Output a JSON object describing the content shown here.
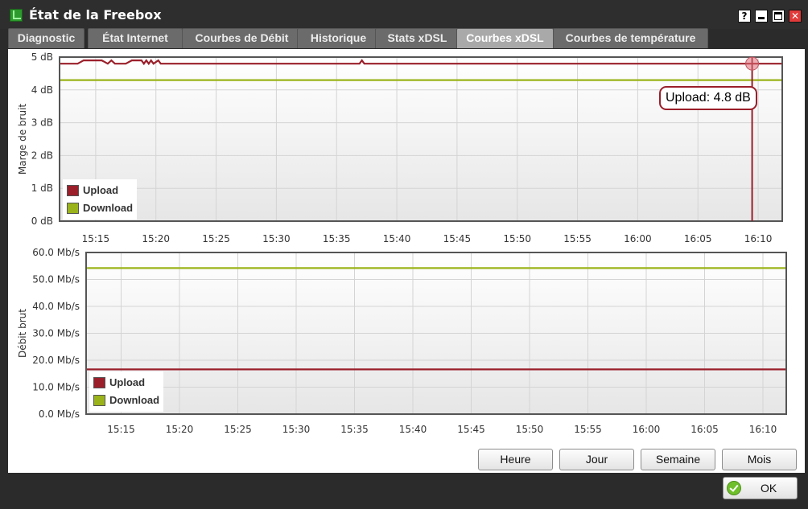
{
  "window": {
    "title": "État de la Freebox",
    "controls": {
      "help": "?",
      "close": "✕"
    }
  },
  "tabs": [
    {
      "label": "Diagnostic",
      "active": false
    },
    {
      "label": "État Internet",
      "active": false
    },
    {
      "label": "Courbes de Débit",
      "active": false
    },
    {
      "label": "Historique",
      "active": false
    },
    {
      "label": "Stats xDSL",
      "active": false
    },
    {
      "label": "Courbes xDSL",
      "active": true
    },
    {
      "label": "Courbes de température",
      "active": false
    }
  ],
  "chart_data": [
    {
      "type": "line",
      "ylabel": "Marge de bruit",
      "yticks": [
        "0 dB",
        "1 dB",
        "2 dB",
        "3 dB",
        "4 dB",
        "5 dB"
      ],
      "ylim": [
        0,
        5
      ],
      "xticks": [
        "15:15",
        "15:20",
        "15:25",
        "15:30",
        "15:35",
        "15:40",
        "15:45",
        "15:50",
        "15:55",
        "16:00",
        "16:05",
        "16:10"
      ],
      "series": [
        {
          "name": "Upload",
          "color": "#9a1f2a",
          "points": [
            [
              "15:12",
              4.8
            ],
            [
              "15:13.5",
              4.8
            ],
            [
              "15:14",
              4.9
            ],
            [
              "15:15.5",
              4.9
            ],
            [
              "15:16",
              4.8
            ],
            [
              "15:16.3",
              4.9
            ],
            [
              "15:16.6",
              4.8
            ],
            [
              "15:17.5",
              4.8
            ],
            [
              "15:18",
              4.9
            ],
            [
              "15:18.8",
              4.9
            ],
            [
              "15:19",
              4.8
            ],
            [
              "15:19.2",
              4.9
            ],
            [
              "15:19.4",
              4.8
            ],
            [
              "15:19.6",
              4.9
            ],
            [
              "15:19.8",
              4.8
            ],
            [
              "15:20.2",
              4.9
            ],
            [
              "15:20.4",
              4.8
            ],
            [
              "15:36.9",
              4.8
            ],
            [
              "15:37.1",
              4.9
            ],
            [
              "15:37.3",
              4.8
            ],
            [
              "16:12",
              4.8
            ]
          ]
        },
        {
          "name": "Download",
          "color": "#9bb31a",
          "points": [
            [
              "15:12",
              4.3
            ],
            [
              "16:12",
              4.3
            ]
          ]
        }
      ],
      "tooltip": "Upload: 4.8 dB",
      "cursor_x": "16:09.5",
      "grid": true,
      "legend": "bottom-left"
    },
    {
      "type": "line",
      "ylabel": "Débit brut",
      "yticks": [
        "0.0 Mb/s",
        "10.0 Mb/s",
        "20.0 Mb/s",
        "30.0 Mb/s",
        "40.0 Mb/s",
        "50.0 Mb/s",
        "60.0 Mb/s"
      ],
      "ylim": [
        0,
        60
      ],
      "xticks": [
        "15:15",
        "15:20",
        "15:25",
        "15:30",
        "15:35",
        "15:40",
        "15:45",
        "15:50",
        "15:55",
        "16:00",
        "16:05",
        "16:10"
      ],
      "series": [
        {
          "name": "Upload",
          "color": "#9a1f2a",
          "points": [
            [
              "15:12",
              16.6
            ],
            [
              "16:12",
              16.6
            ]
          ]
        },
        {
          "name": "Download",
          "color": "#9bb31a",
          "points": [
            [
              "15:12",
              54.2
            ],
            [
              "16:12",
              54.2
            ]
          ]
        }
      ],
      "grid": true,
      "legend": "bottom-left"
    }
  ],
  "range_buttons": [
    {
      "label": "Heure"
    },
    {
      "label": "Jour"
    },
    {
      "label": "Semaine"
    },
    {
      "label": "Mois"
    }
  ],
  "footer": {
    "ok_label": "OK"
  }
}
